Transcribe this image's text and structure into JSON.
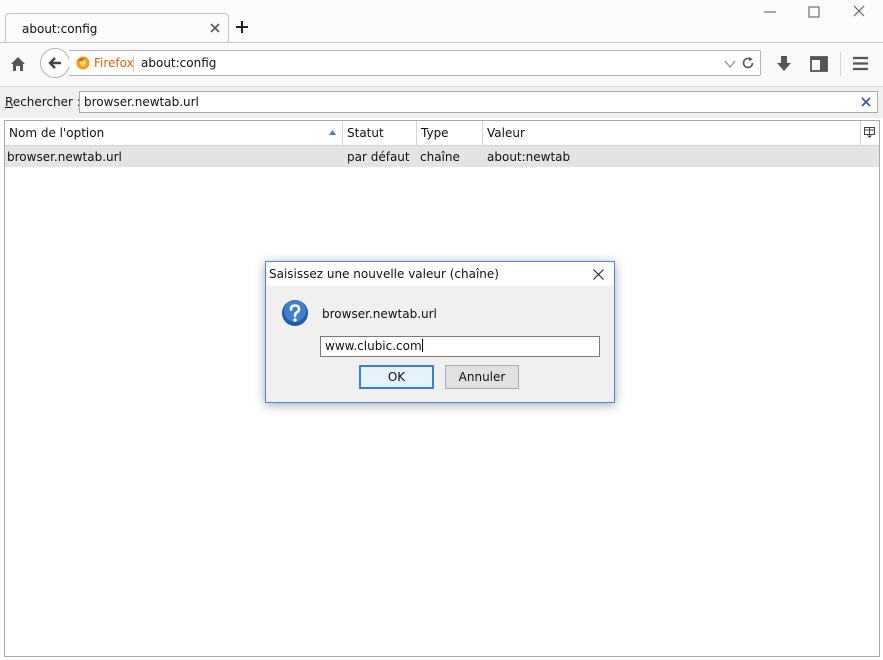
{
  "tab": {
    "title": "about:config"
  },
  "navbar": {
    "identity_label": "Firefox",
    "url": "about:config"
  },
  "search": {
    "label_first": "R",
    "label_rest": "echercher :",
    "value": "browser.newtab.url"
  },
  "table": {
    "columns": [
      "Nom de l'option",
      "Statut",
      "Type",
      "Valeur"
    ],
    "rows": [
      {
        "name": "browser.newtab.url",
        "status": "par défaut",
        "type": "chaîne",
        "value": "about:newtab"
      }
    ]
  },
  "dialog": {
    "title": "Saisissez une nouvelle valeur (chaîne)",
    "pref_name": "browser.newtab.url",
    "input_value": "www.clubic.com",
    "ok_label": "OK",
    "cancel_label": "Annuler"
  },
  "colors": {
    "firefox_label": "#e66000",
    "selected_row": "#e4e4e4",
    "dialog_border": "#3c8ae6",
    "question_icon": "#1e5ba8"
  },
  "icons": [
    "close-tab-icon",
    "plus-icon",
    "minimize-icon",
    "maximize-icon",
    "close-window-icon",
    "home-icon",
    "back-arrow-icon",
    "firefox-icon",
    "dropdown-arrow-icon",
    "reload-icon",
    "download-icon",
    "library-icon",
    "hamburger-menu-icon",
    "clear-search-icon",
    "sort-ascending-icon",
    "column-picker-icon",
    "question-icon"
  ]
}
